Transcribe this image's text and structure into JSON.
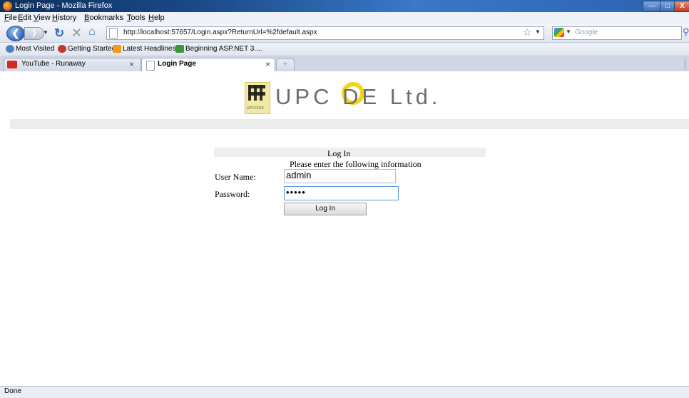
{
  "window": {
    "title": "Login Page - Mozilla Firefox",
    "controls": {
      "minimize": "—",
      "maximize": "□",
      "close": "X"
    }
  },
  "menu": [
    "File",
    "Edit",
    "View",
    "History",
    "Bookmarks",
    "Tools",
    "Help"
  ],
  "nav": {
    "back_icon": "back-arrow-icon",
    "forward_icon": "forward-arrow-icon",
    "url": "http://localhost:57657/Login.aspx?ReturnUrl=%2fdefault.aspx",
    "search_placeholder": "Google"
  },
  "bookmarks": [
    {
      "label": "Most Visited",
      "icon": "most-visited-icon",
      "color": "#4d7fc7"
    },
    {
      "label": "Getting Started",
      "icon": "firefox-icon",
      "color": "#c0392b"
    },
    {
      "label": "Latest Headlines",
      "icon": "rss-icon",
      "color": "#f39c12"
    },
    {
      "label": "Beginning ASP.NET 3....",
      "icon": "asp-icon",
      "color": "#3a9a3a"
    }
  ],
  "tabs": [
    {
      "label": "YouTube - Runaway",
      "active": false,
      "icon": "youtube-icon"
    },
    {
      "label": "Login Page",
      "active": true,
      "icon": "page-icon"
    }
  ],
  "page": {
    "logo_text": "UPC  DE Ltd.",
    "logo_mark_label": "UPCODE",
    "accent_color": "#f3d51b",
    "login": {
      "title": "Log In",
      "instructions": "Please enter the following information",
      "username_label": "User Name:",
      "username_value": "admin",
      "password_label": "Password:",
      "password_value": "•••••",
      "submit_label": "Log In"
    }
  },
  "status": "Done"
}
